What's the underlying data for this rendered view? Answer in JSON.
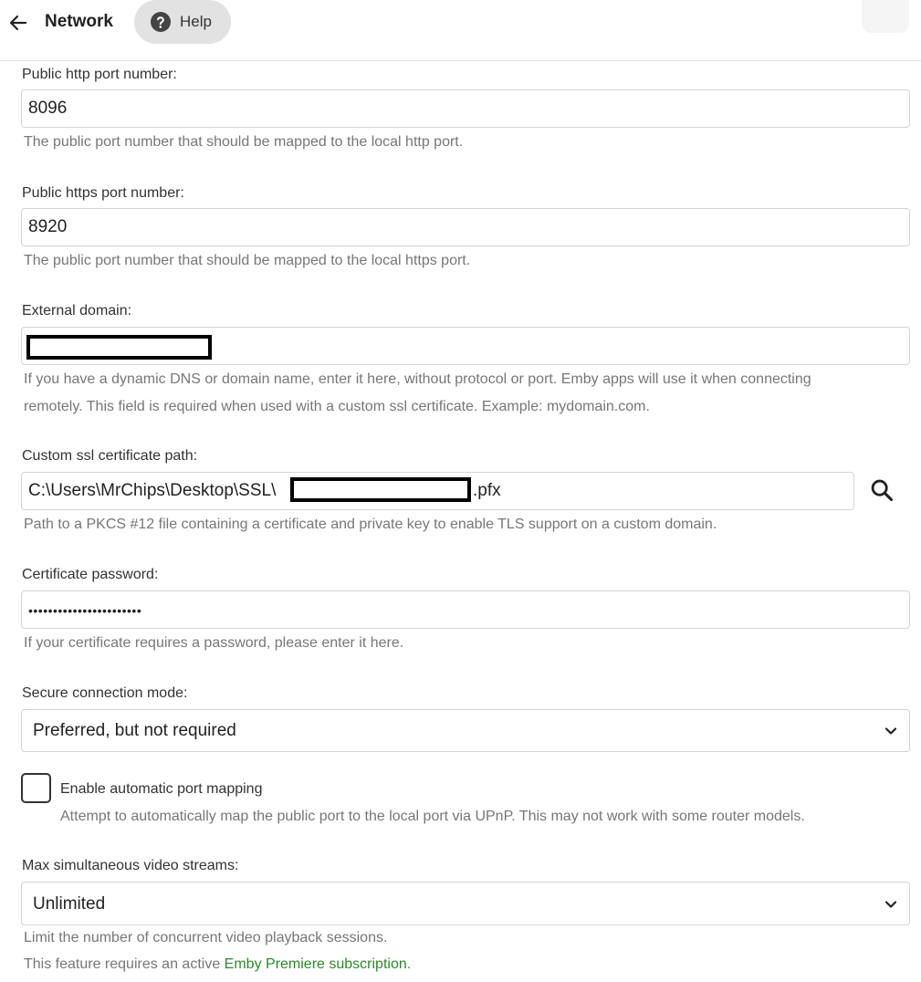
{
  "header": {
    "title": "Network",
    "help_label": "Help"
  },
  "public_http": {
    "label": "Public http port number:",
    "value": "8096",
    "help": "The public port number that should be mapped to the local http port."
  },
  "public_https": {
    "label": "Public https port number:",
    "value": "8920",
    "help": "The public port number that should be mapped to the local https port."
  },
  "external_domain": {
    "label": "External domain:",
    "help_line1": "If you have a dynamic DNS or domain name, enter it here, without protocol or port. Emby apps will use it when connecting",
    "help_line2": "remotely. This field is required when used with a custom ssl certificate. Example: mydomain.com."
  },
  "ssl_path": {
    "label": "Custom ssl certificate path:",
    "value_prefix": "C:\\Users\\MrChips\\Desktop\\SSL\\",
    "value_suffix": ".pfx",
    "help": "Path to a PKCS #12 file containing a certificate and private key to enable TLS support on a custom domain."
  },
  "cert_password": {
    "label": "Certificate password:",
    "value": "•••••••••••••••••••••••",
    "help": "If your certificate requires a password, please enter it here."
  },
  "secure_mode": {
    "label": "Secure connection mode:",
    "selected": "Preferred, but not required"
  },
  "port_mapping": {
    "label": "Enable automatic port mapping",
    "checked": false,
    "help": "Attempt to automatically map the public port to the local port via UPnP. This may not work with some router models."
  },
  "max_streams": {
    "label": "Max simultaneous video streams:",
    "selected": "Unlimited",
    "help_line1": "Limit the number of concurrent video playback sessions.",
    "help_line2_prefix": "This feature requires an active ",
    "help_link": "Emby Premiere subscription",
    "help_line2_suffix": "."
  },
  "colors": {
    "link_green": "#2a8a2a",
    "help_button_bg": "#e2e2e2"
  },
  "icons": {
    "back": "arrow-left-icon",
    "help": "question-circle-icon",
    "search": "search-icon",
    "chevron": "chevron-down-icon"
  }
}
